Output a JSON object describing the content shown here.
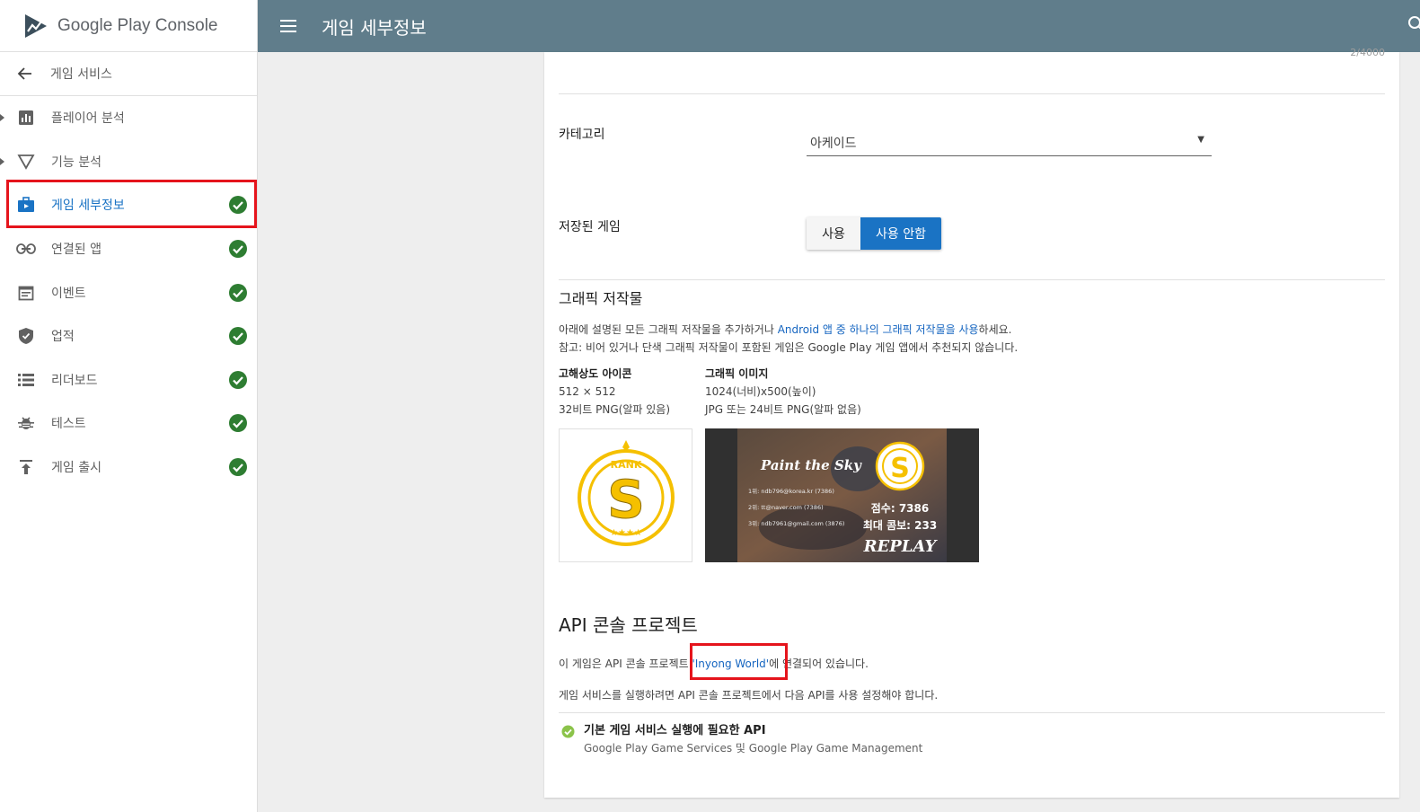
{
  "app": {
    "logo_text": "Google Play Console"
  },
  "header": {
    "title": "게임 세부정보"
  },
  "sidebar": {
    "back_label": "게임 서비스",
    "items": [
      {
        "label": "플레이어 분석",
        "icon": "bar-chart-icon",
        "expandable": true,
        "checked": false
      },
      {
        "label": "기능 분석",
        "icon": "funnel-icon",
        "expandable": true,
        "checked": false
      },
      {
        "label": "게임 세부정보",
        "icon": "game-details-icon",
        "active": true,
        "checked": true
      },
      {
        "label": "연결된 앱",
        "icon": "link-icon",
        "checked": true
      },
      {
        "label": "이벤트",
        "icon": "event-icon",
        "checked": true
      },
      {
        "label": "업적",
        "icon": "shield-icon",
        "checked": true
      },
      {
        "label": "리더보드",
        "icon": "list-icon",
        "checked": true
      },
      {
        "label": "테스트",
        "icon": "bug-icon",
        "checked": true
      },
      {
        "label": "게임 출시",
        "icon": "publish-icon",
        "checked": true
      }
    ],
    "check_color": "#2e7d32",
    "active_color": "#1a73c4"
  },
  "form": {
    "category_label": "카테고리",
    "category_value": "아케이드",
    "saved_games_label": "저장된 게임",
    "saved_games_options": [
      "사용",
      "사용 안함"
    ],
    "saved_games_selected": "사용 안함"
  },
  "graphics": {
    "title": "그래픽 저작물",
    "desc_prefix": "아래에 설명된 모든 그래픽 저작물을 추가하거나 ",
    "desc_link": "Android 앱 중 하나의 그래픽 저작물을 사용",
    "desc_suffix": "하세요.",
    "note": "참고: 비어 있거나 단색 그래픽 저작물이 포함된 게임은 Google Play 게임 앱에서 추천되지 않습니다.",
    "icon_spec": {
      "title": "고해상도 아이콘",
      "size": "512 × 512",
      "format": "32비트 PNG(알파 있음)"
    },
    "feature_spec": {
      "title": "그래픽 이미지",
      "size": "1024(너비)x500(높이)",
      "format": "JPG 또는 24비트 PNG(알파 없음)"
    },
    "icon_image": {
      "badge_text": "RANK",
      "letter": "S",
      "stars": "★★★★"
    },
    "feature_image": {
      "game_title": "Paint the Sky",
      "ranks": [
        "1위: ndb796@korea.kr (7386)",
        "2위: tt@naver.com (7386)",
        "3위: ndb7961@gmail.com (3876)"
      ],
      "score": "점수: 7386",
      "combo": "최대 콤보: 233",
      "replay": "REPLAY"
    }
  },
  "api": {
    "title": "API 콘솔 프로젝트",
    "line1_prefix": "이 게임은 API 콘솔 프로젝트 ",
    "line1_link": "'Inyong World'",
    "line1_suffix": "에 연결되어 있습니다.",
    "line2": "게임 서비스를 실행하려면 API 콘솔 프로젝트에서 다음 API를 사용 설정해야 합니다.",
    "requirement_title": "기본 게임 서비스 실행에 필요한 API",
    "requirement_sub": "Google Play Game Services 및 Google Play Game Management"
  },
  "counter_text": "2/4000"
}
